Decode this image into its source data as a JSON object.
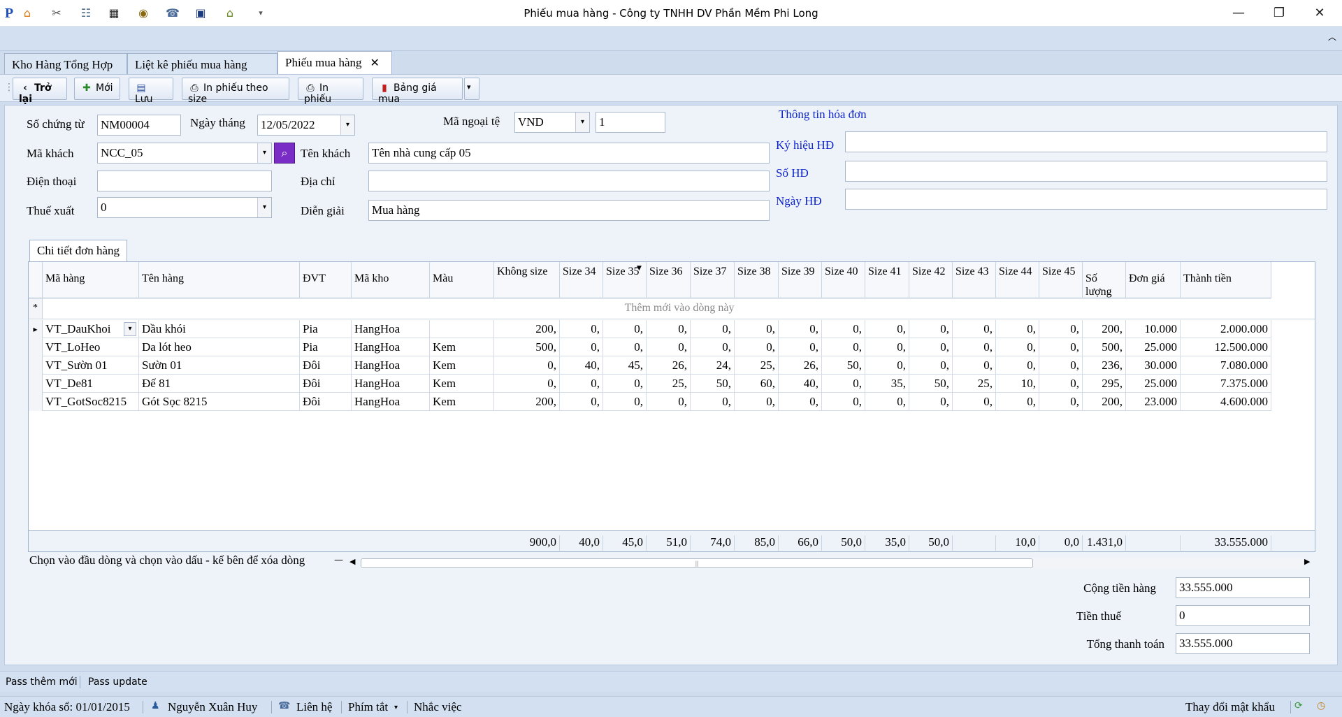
{
  "window": {
    "title": "Phiếu mua hàng - Công ty TNHH DV Phần Mềm Phi Long",
    "minimize": "—",
    "maximize": "❐",
    "close": "✕"
  },
  "tabs": [
    {
      "label": "Kho Hàng Tổng Hợp"
    },
    {
      "label": "Liệt kê phiếu mua hàng"
    },
    {
      "label": "Phiếu mua hàng",
      "close": "✕"
    }
  ],
  "toolbar": {
    "back": "Trở lại",
    "new": "Mới",
    "save": "Lưu",
    "print_size": "In phiếu theo size",
    "print": "In phiếu",
    "price_table": "Bảng giá mua"
  },
  "form": {
    "so_chung_tu_label": "Số chứng từ",
    "so_chung_tu": "NM00004",
    "ngay_thang_label": "Ngày tháng",
    "ngay_thang": "12/05/2022",
    "ma_ngoai_te_label": "Mã ngoại tệ",
    "ma_ngoai_te": "VND",
    "ty_gia": "1",
    "ma_khach_label": "Mã khách",
    "ma_khach": "NCC_05",
    "ten_khach_label": "Tên khách",
    "ten_khach": "Tên nhà cung cấp 05",
    "dien_thoai_label": "Điện thoại",
    "dien_thoai": "",
    "dia_chi_label": "Địa chỉ",
    "dia_chi": "",
    "thue_xuat_label": "Thuế xuất",
    "thue_xuat": "0",
    "dien_giai_label": "Diễn giải",
    "dien_giai": "Mua hàng"
  },
  "invoice": {
    "title": "Thông tin hóa đơn",
    "ky_hieu_label": "Ký hiệu HĐ",
    "ky_hieu": "",
    "so_hd_label": "Số HĐ",
    "so_hd": "",
    "ngay_hd_label": "Ngày HĐ",
    "ngay_hd": ""
  },
  "detail": {
    "tab_label": "Chi tiết đơn hàng",
    "new_row_marker": "*",
    "new_row_text": "Thêm mới vào dòng này",
    "columns": [
      "Mã hàng",
      "Tên hàng",
      "ĐVT",
      "Mã kho",
      "Màu",
      "Không size",
      "Size 34",
      "Size 35",
      "Size 36",
      "Size 37",
      "Size 38",
      "Size 39",
      "Size 40",
      "Size 41",
      "Size 42",
      "Size 43",
      "Size 44",
      "Size 45",
      "Số lượng",
      "Đơn giá",
      "Thành tiền"
    ],
    "rows": [
      [
        "VT_DauKhoi",
        "Dầu khói",
        "Pia",
        "HangHoa",
        "",
        "200,",
        "0,",
        "0,",
        "0,",
        "0,",
        "0,",
        "0,",
        "0,",
        "0,",
        "0,",
        "0,",
        "0,",
        "0,",
        "200,",
        "10.000",
        "2.000.000"
      ],
      [
        "VT_LoHeo",
        "Da lót heo",
        "Pia",
        "HangHoa",
        "Kem",
        "500,",
        "0,",
        "0,",
        "0,",
        "0,",
        "0,",
        "0,",
        "0,",
        "0,",
        "0,",
        "0,",
        "0,",
        "0,",
        "500,",
        "25.000",
        "12.500.000"
      ],
      [
        "VT_Sườn 01",
        "Sườn 01",
        "Đôi",
        "HangHoa",
        "Kem",
        "0,",
        "40,",
        "45,",
        "26,",
        "24,",
        "25,",
        "26,",
        "50,",
        "0,",
        "0,",
        "0,",
        "0,",
        "0,",
        "236,",
        "30.000",
        "7.080.000"
      ],
      [
        "VT_De81",
        "Đế 81",
        "Đôi",
        "HangHoa",
        "Kem",
        "0,",
        "0,",
        "0,",
        "25,",
        "50,",
        "60,",
        "40,",
        "0,",
        "35,",
        "50,",
        "25,",
        "10,",
        "0,",
        "295,",
        "25.000",
        "7.375.000"
      ],
      [
        "VT_GotSoc8215",
        "Gót Sọc 8215",
        "Đôi",
        "HangHoa",
        "Kem",
        "200,",
        "0,",
        "0,",
        "0,",
        "0,",
        "0,",
        "0,",
        "0,",
        "0,",
        "0,",
        "0,",
        "0,",
        "0,",
        "200,",
        "23.000",
        "4.600.000"
      ]
    ],
    "footer": [
      "",
      "",
      "",
      "",
      "",
      "900,0",
      "40,0",
      "45,0",
      "51,0",
      "74,0",
      "85,0",
      "66,0",
      "50,0",
      "35,0",
      "50,0",
      "",
      "10,0",
      "0,0",
      "1.431,0",
      "",
      "33.555.000"
    ],
    "hint": "Chọn vào đầu dòng và chọn vào dấu - kế bên để xóa dòng"
  },
  "totals": {
    "cong_tien_hang_label": "Cộng tiền hàng",
    "cong_tien_hang": "33.555.000",
    "tien_thue_label": "Tiền thuế",
    "tien_thue": "0",
    "tong_thanh_toan_label": "Tổng thanh toán",
    "tong_thanh_toan": "33.555.000"
  },
  "passbar": {
    "pass_new": "Pass thêm mới",
    "pass_update": "Pass update"
  },
  "status": {
    "lock_date": "Ngày khóa sổ: 01/01/2015",
    "user": "Nguyễn Xuân Huy",
    "contact": "Liên hệ",
    "shortcut": "Phím tắt",
    "reminder": "Nhắc việc",
    "change_password": "Thay đổi mật khẩu"
  }
}
